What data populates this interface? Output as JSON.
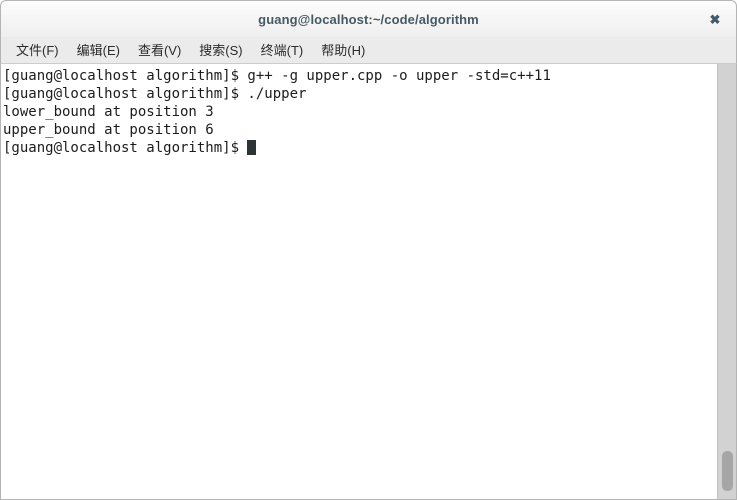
{
  "window": {
    "title": "guang@localhost:~/code/algorithm",
    "close_icon": "close-icon",
    "close_glyph": "✖",
    "accent_title_color": "#455a64",
    "titlebar_bg": "#f6f6f6",
    "menubar_bg": "#ebebeb",
    "terminal_bg": "#ffffff",
    "terminal_fg": "#1c1c1c",
    "border_color": "#b4b4b4"
  },
  "menubar": {
    "items": [
      {
        "label": "文件(F)",
        "name": "menu-file"
      },
      {
        "label": "编辑(E)",
        "name": "menu-edit"
      },
      {
        "label": "查看(V)",
        "name": "menu-view"
      },
      {
        "label": "搜索(S)",
        "name": "menu-search"
      },
      {
        "label": "终端(T)",
        "name": "menu-terminal"
      },
      {
        "label": "帮助(H)",
        "name": "menu-help"
      }
    ]
  },
  "terminal": {
    "prompt": "[guang@localhost algorithm]$ ",
    "lines": [
      "[guang@localhost algorithm]$ g++ -g upper.cpp -o upper -std=c++11",
      "[guang@localhost algorithm]$ ./upper",
      "lower_bound at position 3",
      "upper_bound at position 6"
    ],
    "current_line": "[guang@localhost algorithm]$ ",
    "cursor_color": "#2d3436"
  },
  "scrollbar": {
    "track_color": "#d2d2d2",
    "thumb_color": "#a6a6a6",
    "thumb_position": "bottom"
  }
}
